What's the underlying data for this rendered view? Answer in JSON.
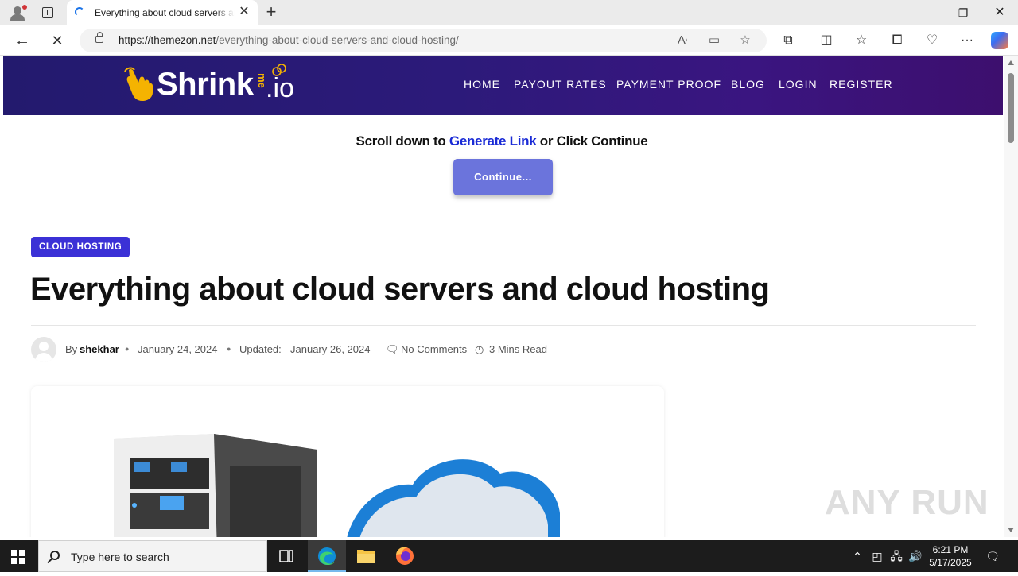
{
  "browser": {
    "tab_title": "Everything about cloud servers and cloud hosting",
    "tab_close": "✕",
    "new_tab": "+",
    "url_host": "https://themezon.net",
    "url_path": "/everything-about-cloud-servers-and-cloud-hosting/",
    "window_min": "—",
    "window_restore": "❐",
    "window_close": "✕",
    "back_glyph": "←",
    "stop_glyph": "✕",
    "more_glyph": "···"
  },
  "shrink_header": {
    "logo_word": "Shrink",
    "logo_me": "me",
    "logo_io": ".io",
    "nav": [
      "HOME",
      "PAYOUT RATES",
      "PAYMENT PROOF",
      "BLOG",
      "LOGIN",
      "REGISTER"
    ]
  },
  "promo": {
    "prefix": "Scroll down to ",
    "link": "Generate Link",
    "suffix": " or Click Continue",
    "continue_label": "Continue..."
  },
  "article": {
    "category": "CLOUD HOSTING",
    "title": "Everything about cloud servers and cloud hosting",
    "by": "By",
    "author": "shekhar",
    "published": "January 24, 2024",
    "updated_label": "Updated:",
    "updated": "January 26, 2024",
    "comments": "No Comments",
    "read_time": "3 Mins Read"
  },
  "watermark": "ANY RUN",
  "taskbar": {
    "search_placeholder": "Type here to search",
    "time": "6:21 PM",
    "date": "5/17/2025"
  },
  "colors": {
    "header_gradient_start": "#231a6e",
    "header_gradient_end": "#3d0f6e",
    "generate_link": "#1a2bd6",
    "continue_button": "#6b74dc",
    "category_badge": "#3b31d6",
    "logo_accent": "#f5b301"
  }
}
